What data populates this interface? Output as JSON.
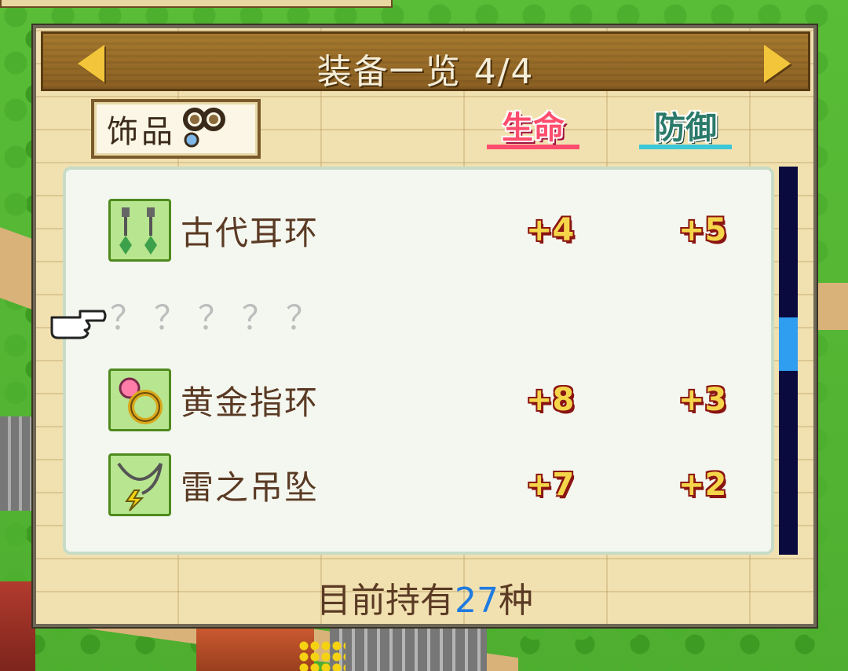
{
  "header": {
    "title": "装备一览 4/4"
  },
  "category": {
    "label": "饰品",
    "icon": "accessory-icon"
  },
  "columns": {
    "hp": "生命",
    "defense": "防御"
  },
  "items": [
    {
      "name": "古代耳环",
      "hp": "+4",
      "defense": "+5",
      "icon": "earring-icon"
    },
    {
      "name": "？？？？？",
      "hp": "",
      "defense": "",
      "icon": ""
    },
    {
      "name": "黄金指环",
      "hp": "+8",
      "defense": "+3",
      "icon": "ring-icon"
    },
    {
      "name": "雷之吊坠",
      "hp": "+7",
      "defense": "+2",
      "icon": "pendant-icon"
    }
  ],
  "footer": {
    "prefix": "目前持有",
    "count": "27",
    "suffix": "种"
  },
  "scroll": {
    "position_fraction": 0.45
  },
  "colors": {
    "accent": "#2f9df0",
    "hp": "#ff4d6d",
    "defense": "#3dc7d8",
    "stat_text": "#f5d64a"
  }
}
